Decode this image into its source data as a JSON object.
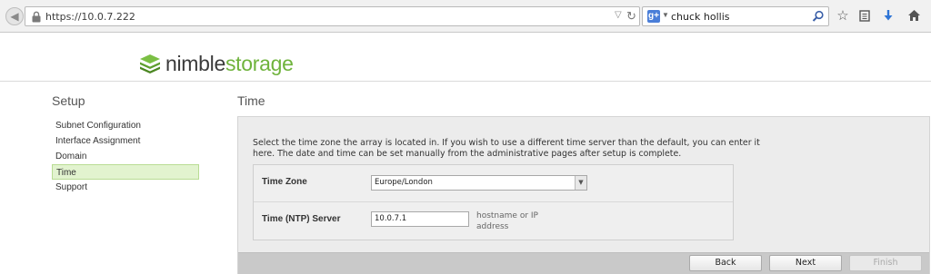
{
  "browser": {
    "url": "https://10.0.7.222",
    "search_engine": "g+",
    "search_text": "chuck hollis"
  },
  "brand": {
    "name_part1": "nimble",
    "name_part2": "storage",
    "accent_color": "#6fb33c"
  },
  "sidebar": {
    "title": "Setup",
    "items": [
      {
        "label": "Subnet Configuration",
        "active": false
      },
      {
        "label": "Interface Assignment",
        "active": false
      },
      {
        "label": "Domain",
        "active": false
      },
      {
        "label": "Time",
        "active": true
      },
      {
        "label": "Support",
        "active": false
      }
    ]
  },
  "main": {
    "title": "Time",
    "description": "Select the time zone the array is located in. If you wish to use a different time server than the default, you can enter it here. The date and time can be set manually from the administrative pages after setup is complete.",
    "time_zone": {
      "label": "Time Zone",
      "value": "Europe/London"
    },
    "ntp": {
      "label": "Time (NTP) Server",
      "value": "10.0.7.1",
      "hint": "hostname or IP address"
    }
  },
  "footer": {
    "back_label": "Back",
    "next_label": "Next",
    "finish_label": "Finish"
  },
  "icons": {
    "reload": "reload-icon",
    "search": "search-icon",
    "star": "star-icon",
    "clipboard": "clipboard-icon",
    "download": "download-icon",
    "home": "home-icon"
  }
}
